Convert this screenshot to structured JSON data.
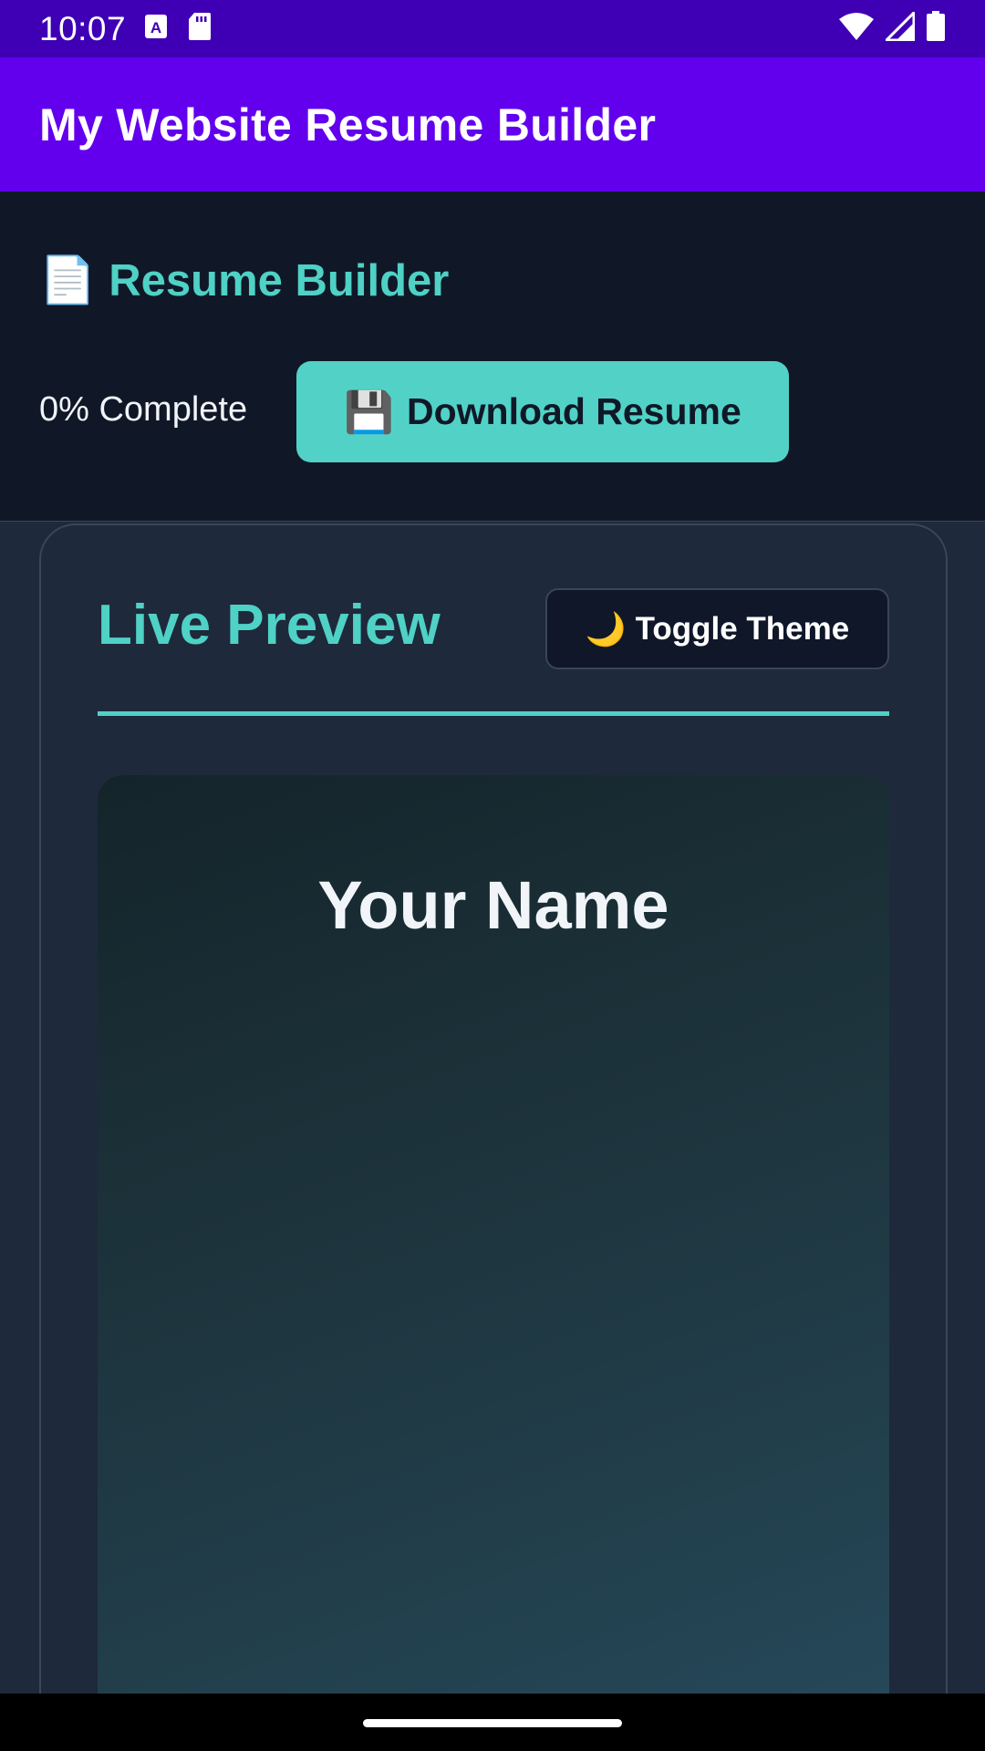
{
  "status_bar": {
    "time": "10:07",
    "icons": [
      "font-download-icon",
      "sd-card-icon",
      "wifi-icon",
      "cell-signal-icon",
      "battery-icon"
    ]
  },
  "app_bar": {
    "title": "My Website Resume Builder"
  },
  "builder": {
    "icon": "📄",
    "title": "Resume Builder",
    "progress_text": "0% Complete",
    "progress_value": 0,
    "download_icon": "💾",
    "download_label": "Download Resume"
  },
  "preview": {
    "title": "Live Preview",
    "toggle_icon": "🌙",
    "toggle_label": "Toggle Theme",
    "resume_name": "Your Name"
  },
  "colors": {
    "status_bar": "#3f00b5",
    "app_bar": "#6200ee",
    "accent_teal": "#4fd1c5",
    "background_dark": "#0f1729",
    "card_dark": "#1e293b"
  }
}
